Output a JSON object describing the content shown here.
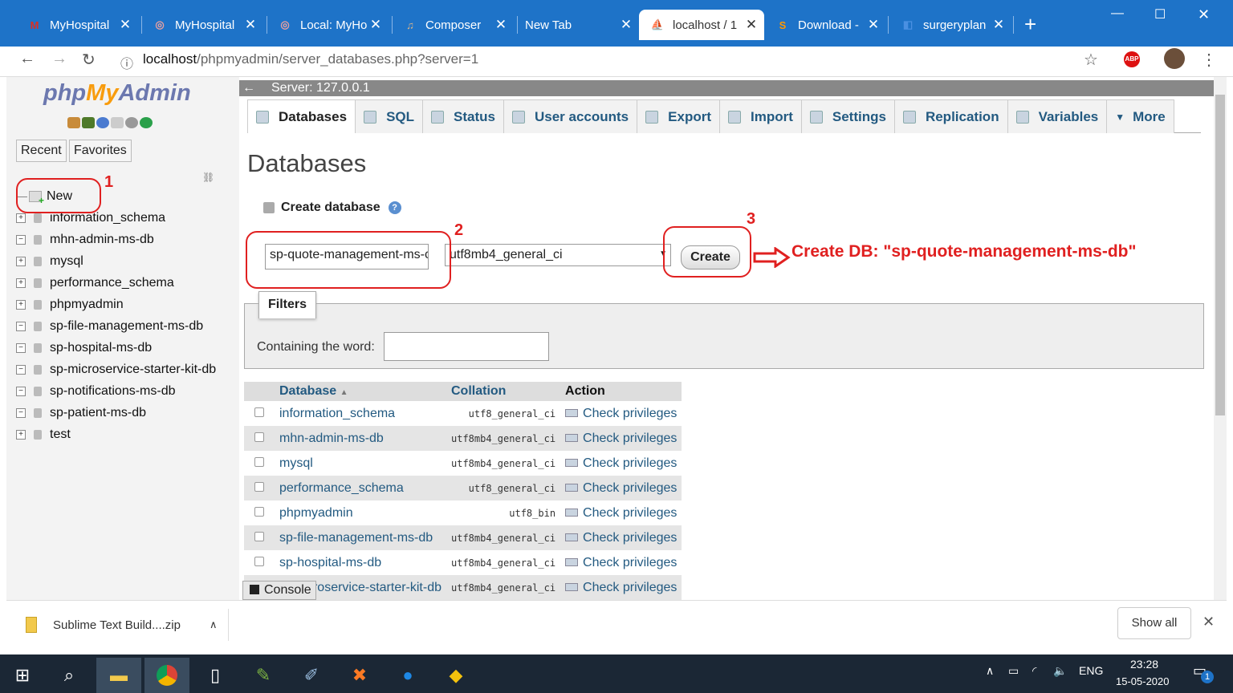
{
  "browser": {
    "tabs": [
      {
        "label": "MyHospital",
        "icon": "gmail-icon",
        "icon_color": "#d93025"
      },
      {
        "label": "MyHospital",
        "icon": "web-icon",
        "icon_color": "#e8a0a0"
      },
      {
        "label": "Local: MyHo",
        "icon": "web-icon",
        "icon_color": "#e8a0a0"
      },
      {
        "label": "Composer",
        "icon": "composer-icon",
        "icon_color": "#6b4c2a"
      },
      {
        "label": "New Tab",
        "icon": "",
        "icon_color": ""
      },
      {
        "label": "localhost / 1",
        "icon": "pma-icon",
        "icon_color": "#f89c0e"
      },
      {
        "label": "Download -",
        "icon": "sublime-icon",
        "icon_color": "#ff9800"
      },
      {
        "label": "surgeryplan",
        "icon": "web-icon",
        "icon_color": "#4a90e2"
      }
    ],
    "url_host": "localhost",
    "url_path": "/phpmyadmin/server_databases.php?server=1",
    "abp": "ABP"
  },
  "sidebar": {
    "logo_php": "php",
    "logo_my": "My",
    "logo_admin": "Admin",
    "recent": "Recent",
    "favorites": "Favorites",
    "new_label": "New",
    "databases": [
      "information_schema",
      "mhn-admin-ms-db",
      "mysql",
      "performance_schema",
      "phpmyadmin",
      "sp-file-management-ms-db",
      "sp-hospital-ms-db",
      "sp-microservice-starter-kit-db",
      "sp-notifications-ms-db",
      "sp-patient-ms-db",
      "test"
    ]
  },
  "main": {
    "server": "Server: 127.0.0.1",
    "tabs": [
      "Databases",
      "SQL",
      "Status",
      "User accounts",
      "Export",
      "Import",
      "Settings",
      "Replication",
      "Variables",
      "More"
    ],
    "title": "Databases",
    "create_label": "Create database",
    "db_name_value": "sp-quote-management-ms-c",
    "collation_value": "utf8mb4_general_ci",
    "create_button": "Create",
    "filters": "Filters",
    "containing": "Containing the word:",
    "table_headers": {
      "database": "Database",
      "collation": "Collation",
      "action": "Action"
    },
    "rows": [
      {
        "db": "information_schema",
        "collation": "utf8_general_ci",
        "action": "Check privileges"
      },
      {
        "db": "mhn-admin-ms-db",
        "collation": "utf8mb4_general_ci",
        "action": "Check privileges"
      },
      {
        "db": "mysql",
        "collation": "utf8mb4_general_ci",
        "action": "Check privileges"
      },
      {
        "db": "performance_schema",
        "collation": "utf8_general_ci",
        "action": "Check privileges"
      },
      {
        "db": "phpmyadmin",
        "collation": "utf8_bin",
        "action": "Check privileges"
      },
      {
        "db": "sp-file-management-ms-db",
        "collation": "utf8mb4_general_ci",
        "action": "Check privileges"
      },
      {
        "db": "sp-hospital-ms-db",
        "collation": "utf8mb4_general_ci",
        "action": "Check privileges"
      },
      {
        "db": "roservice-starter-kit-db",
        "collation": "utf8mb4_general_ci",
        "action": "Check privileges"
      }
    ],
    "console": "Console"
  },
  "annotations": {
    "n1": "1",
    "n2": "2",
    "n3": "3",
    "text": "Create DB: \"sp-quote-management-ms-db\"",
    "color": "#e02020"
  },
  "downloads": {
    "file": "Sublime Text Build....zip",
    "show_all": "Show all"
  },
  "taskbar": {
    "lang": "ENG",
    "time": "23:28",
    "date": "15-05-2020",
    "notif": "1"
  }
}
